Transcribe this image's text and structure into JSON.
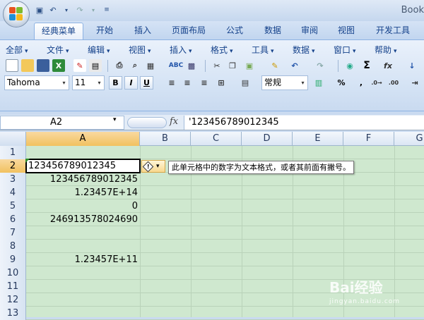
{
  "window": {
    "title": "Book"
  },
  "ribbon_tabs": [
    {
      "label": "经典菜单",
      "active": true
    },
    {
      "label": "开始"
    },
    {
      "label": "插入"
    },
    {
      "label": "页面布局"
    },
    {
      "label": "公式"
    },
    {
      "label": "数据"
    },
    {
      "label": "审阅"
    },
    {
      "label": "视图"
    },
    {
      "label": "开发工具"
    }
  ],
  "menu": [
    "全部",
    "文件",
    "编辑",
    "视图",
    "插入",
    "格式",
    "工具",
    "数据",
    "窗口",
    "帮助"
  ],
  "font": {
    "name": "Tahoma",
    "size": "11"
  },
  "format": {
    "bold": "B",
    "italic": "I",
    "underline": "U",
    "number_format": "常规",
    "percent": "%",
    "comma": ","
  },
  "formula_bar": {
    "name_box": "A2",
    "fx": "fx",
    "content": "'123456789012345"
  },
  "columns": [
    "A",
    "B",
    "C",
    "D",
    "E",
    "F",
    "G"
  ],
  "rows": [
    {
      "num": "1",
      "a": ""
    },
    {
      "num": "2",
      "a": "123456789012345"
    },
    {
      "num": "3",
      "a": "123456789012345"
    },
    {
      "num": "4",
      "a": "1.23457E+14"
    },
    {
      "num": "5",
      "a": "0"
    },
    {
      "num": "6",
      "a": "246913578024690"
    },
    {
      "num": "7",
      "a": ""
    },
    {
      "num": "8",
      "a": ""
    },
    {
      "num": "9",
      "a": "1.23457E+11"
    },
    {
      "num": "10",
      "a": ""
    },
    {
      "num": "11",
      "a": ""
    },
    {
      "num": "12",
      "a": ""
    },
    {
      "num": "13",
      "a": ""
    }
  ],
  "error_tooltip": "此单元格中的数字为文本格式，或者其前面有撇号。",
  "watermark": {
    "main": "Bai经验",
    "sub": "jingyan.baidu.com"
  },
  "colors": {
    "selected_header": "#f1c15f",
    "grid_bg": "#cfe8cf",
    "ribbon_text": "#15428b"
  }
}
